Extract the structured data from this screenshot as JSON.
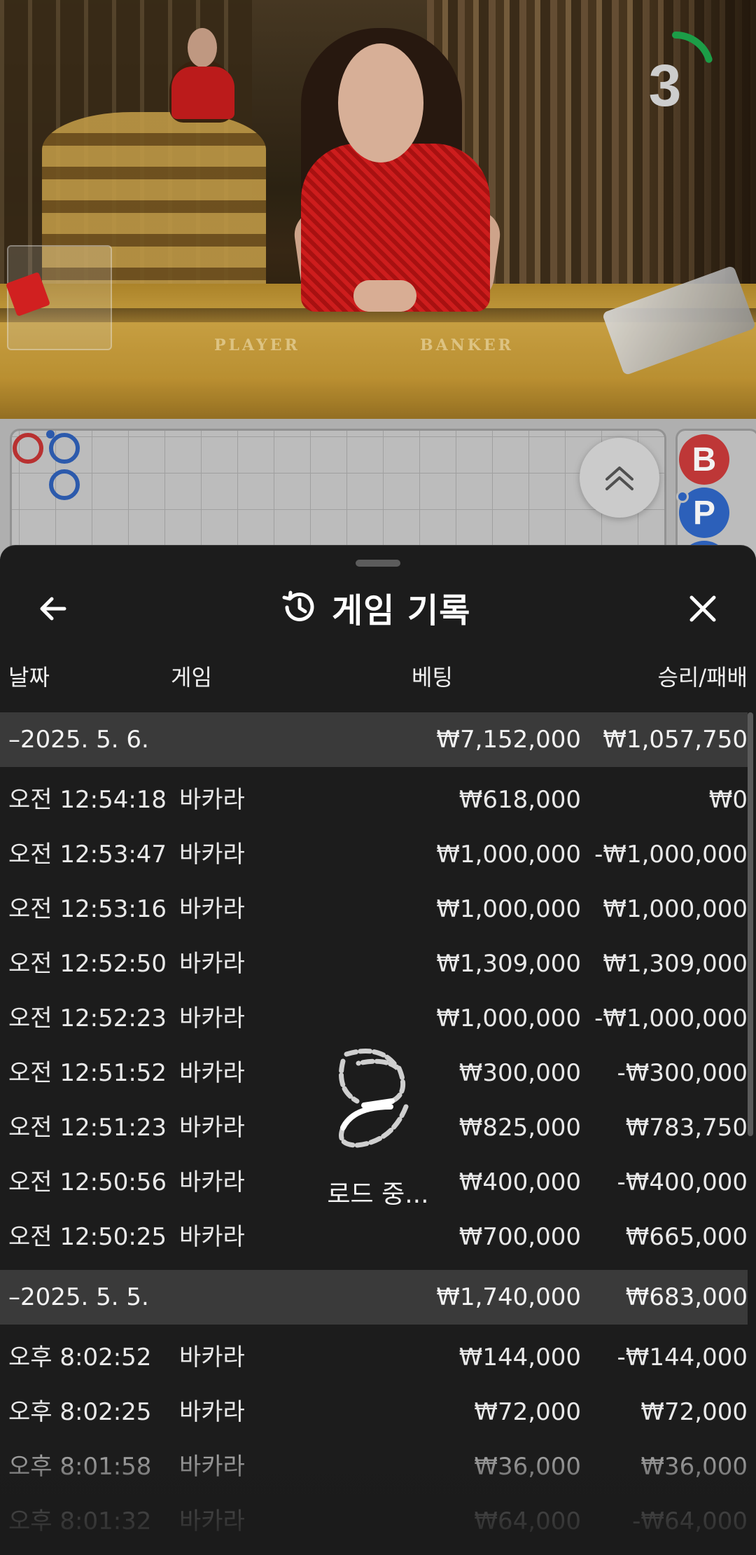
{
  "video": {
    "table_labels": {
      "player": "PLAYER",
      "banker": "BANKER"
    },
    "timer": {
      "value": "3",
      "progress": 0.2,
      "color": "#1ea64b"
    }
  },
  "roadmap": {
    "side_chips": [
      {
        "label": "B",
        "color": "#c93a3a"
      },
      {
        "label": "P",
        "color": "#2f66c4"
      }
    ]
  },
  "sheet": {
    "title": "게임 기록",
    "title_icon": "history-icon",
    "back_icon": "arrow-left-icon",
    "close_icon": "close-icon",
    "columns": {
      "date": "날짜",
      "game": "게임",
      "bet": "베팅",
      "win_loss": "승리/패배"
    },
    "groups": [
      {
        "date": "–2025. 5. 6.",
        "bet": "₩7,152,000",
        "win_loss": "₩1,057,750",
        "rows": [
          {
            "time": "오전 12:54:18",
            "game": "바카라",
            "bet": "₩618,000",
            "win_loss": "₩0"
          },
          {
            "time": "오전 12:53:47",
            "game": "바카라",
            "bet": "₩1,000,000",
            "win_loss": "-₩1,000,000"
          },
          {
            "time": "오전 12:53:16",
            "game": "바카라",
            "bet": "₩1,000,000",
            "win_loss": "₩1,000,000"
          },
          {
            "time": "오전 12:52:50",
            "game": "바카라",
            "bet": "₩1,309,000",
            "win_loss": "₩1,309,000"
          },
          {
            "time": "오전 12:52:23",
            "game": "바카라",
            "bet": "₩1,000,000",
            "win_loss": "-₩1,000,000"
          },
          {
            "time": "오전 12:51:52",
            "game": "바카라",
            "bet": "₩300,000",
            "win_loss": "-₩300,000"
          },
          {
            "time": "오전 12:51:23",
            "game": "바카라",
            "bet": "₩825,000",
            "win_loss": "₩783,750"
          },
          {
            "time": "오전 12:50:56",
            "game": "바카라",
            "bet": "₩400,000",
            "win_loss": "-₩400,000"
          },
          {
            "time": "오전 12:50:25",
            "game": "바카라",
            "bet": "₩700,000",
            "win_loss": "₩665,000"
          }
        ]
      },
      {
        "date": "–2025. 5. 5.",
        "bet": "₩1,740,000",
        "win_loss": "₩683,000",
        "rows": [
          {
            "time": "오후 8:02:52",
            "game": "바카라",
            "bet": "₩144,000",
            "win_loss": "-₩144,000"
          },
          {
            "time": "오후 8:02:25",
            "game": "바카라",
            "bet": "₩72,000",
            "win_loss": "₩72,000"
          },
          {
            "time": "오후 8:01:58",
            "game": "바카라",
            "bet": "₩36,000",
            "win_loss": "₩36,000"
          },
          {
            "time": "오후 8:01:32",
            "game": "바카라",
            "bet": "₩64,000",
            "win_loss": "-₩64,000"
          }
        ]
      }
    ],
    "loading": {
      "label": "로드 중...",
      "icon": "loading-spinner-icon"
    }
  }
}
